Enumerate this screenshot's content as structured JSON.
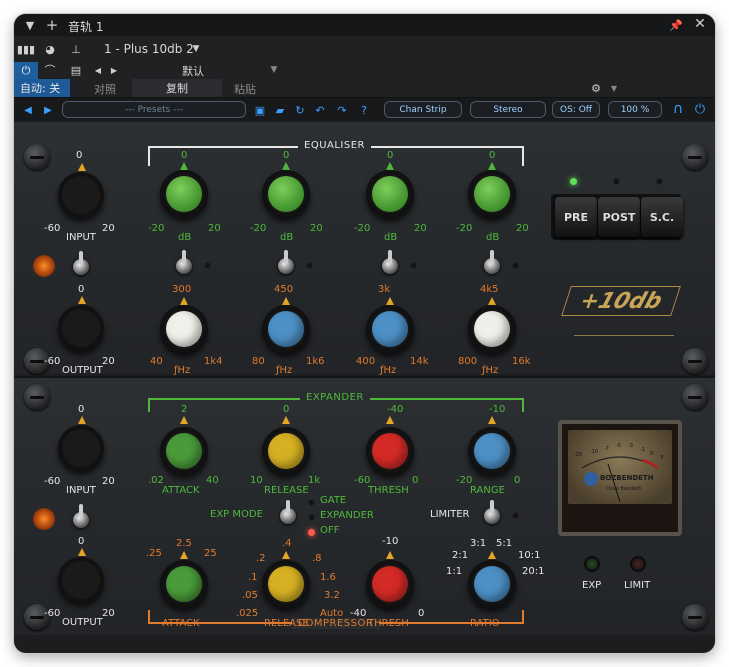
{
  "titlebar": {
    "title": "音轨 1"
  },
  "toolbar": {
    "preset_name": "1 - Plus 10db 2"
  },
  "row3": {
    "preset_label": "默认"
  },
  "row4": {
    "auto_label": "自动: 关",
    "compare_label": "对照",
    "copy_label": "复制",
    "paste_label": "粘贴"
  },
  "plugin_bar": {
    "presets": "--- Presets ---",
    "chan_strip": "Chan Strip",
    "stereo": "Stereo",
    "os": "OS: Off",
    "zoom": "100 %"
  },
  "eq": {
    "title": "EQUALISER",
    "input": {
      "top": "0",
      "min": "-60",
      "max": "20",
      "label": "INPUT"
    },
    "output": {
      "top": "0",
      "min": "-60",
      "max": "20",
      "label": "OUTPUT"
    },
    "bands": [
      {
        "top": "0",
        "min": "-20",
        "max": "20",
        "unit": "dB",
        "freq_top": "300",
        "freq_min": "40",
        "freq_max": "1k4",
        "freq_unit": "ƒHz",
        "cap": "#f0efe9"
      },
      {
        "top": "0",
        "min": "-20",
        "max": "20",
        "unit": "dB",
        "freq_top": "450",
        "freq_min": "80",
        "freq_max": "1k6",
        "freq_unit": "ƒHz",
        "cap": "#4d90c6"
      },
      {
        "top": "0",
        "min": "-20",
        "max": "20",
        "unit": "dB",
        "freq_top": "3k",
        "freq_min": "400",
        "freq_max": "14k",
        "freq_unit": "ƒHz",
        "cap": "#4d90c6"
      },
      {
        "top": "0",
        "min": "-20",
        "max": "20",
        "unit": "dB",
        "freq_top": "4k5",
        "freq_min": "800",
        "freq_max": "16k",
        "freq_unit": "ƒHz",
        "cap": "#f0efe9"
      }
    ],
    "buttons": [
      "PRE",
      "POST",
      "S.C."
    ],
    "logo": "+10db"
  },
  "dyn": {
    "expander_title": "EXPANDER",
    "compressor_title": "COMPRESSOR",
    "input": {
      "top": "0",
      "min": "-60",
      "max": "20",
      "label": "INPUT"
    },
    "output": {
      "top": "0",
      "min": "-60",
      "max": "20",
      "label": "OUTPUT"
    },
    "exp_knobs": [
      {
        "label": "ATTACK",
        "scale": [
          ".02",
          "2",
          "40"
        ],
        "cap": "#4a9a3a"
      },
      {
        "label": "RELEASE",
        "scale": [
          "10",
          "0",
          "1k"
        ],
        "cap": "#d5b023"
      },
      {
        "label": "THRESH",
        "scale": [
          "-60",
          "-40",
          "0"
        ],
        "cap": "#d42a26"
      },
      {
        "label": "RANGE",
        "scale": [
          "-20",
          "-10",
          "0"
        ],
        "cap": "#4d90c6"
      }
    ],
    "exp_mode_label": "EXP MODE",
    "exp_modes": [
      "GATE",
      "EXPANDER",
      "OFF"
    ],
    "limiter_label": "LIMITER",
    "comp_knobs": [
      {
        "label": "ATTACK",
        "scale": [
          ".25",
          "2.5",
          "25"
        ],
        "cap": "#4a9a3a"
      },
      {
        "label": "RELEASE",
        "scale": [
          ".025",
          ".05",
          ".1",
          ".2",
          ".4",
          ".8",
          "1.6",
          "3.2",
          "Auto"
        ],
        "cap": "#d5b023"
      },
      {
        "label": "THRESH",
        "scale": [
          "-40",
          "-10",
          "0"
        ],
        "cap": "#d42a26"
      },
      {
        "label": "RATIO",
        "scale": [
          "1:1",
          "2:1",
          "3:1",
          "5:1",
          "10:1",
          "20:1"
        ],
        "cap": "#4d90c6"
      }
    ],
    "meter": {
      "brand": "BOZBENDETH",
      "sub": "Dave Bendeth",
      "marks": [
        "-20",
        "-10",
        "-7",
        "-5",
        "-3",
        "-1",
        "0",
        "3"
      ]
    },
    "leds": [
      "EXP",
      "LIMIT"
    ]
  },
  "colors": {
    "green": "#4fb83b",
    "orange": "#e07a2e",
    "blue": "#3aa0ff"
  }
}
